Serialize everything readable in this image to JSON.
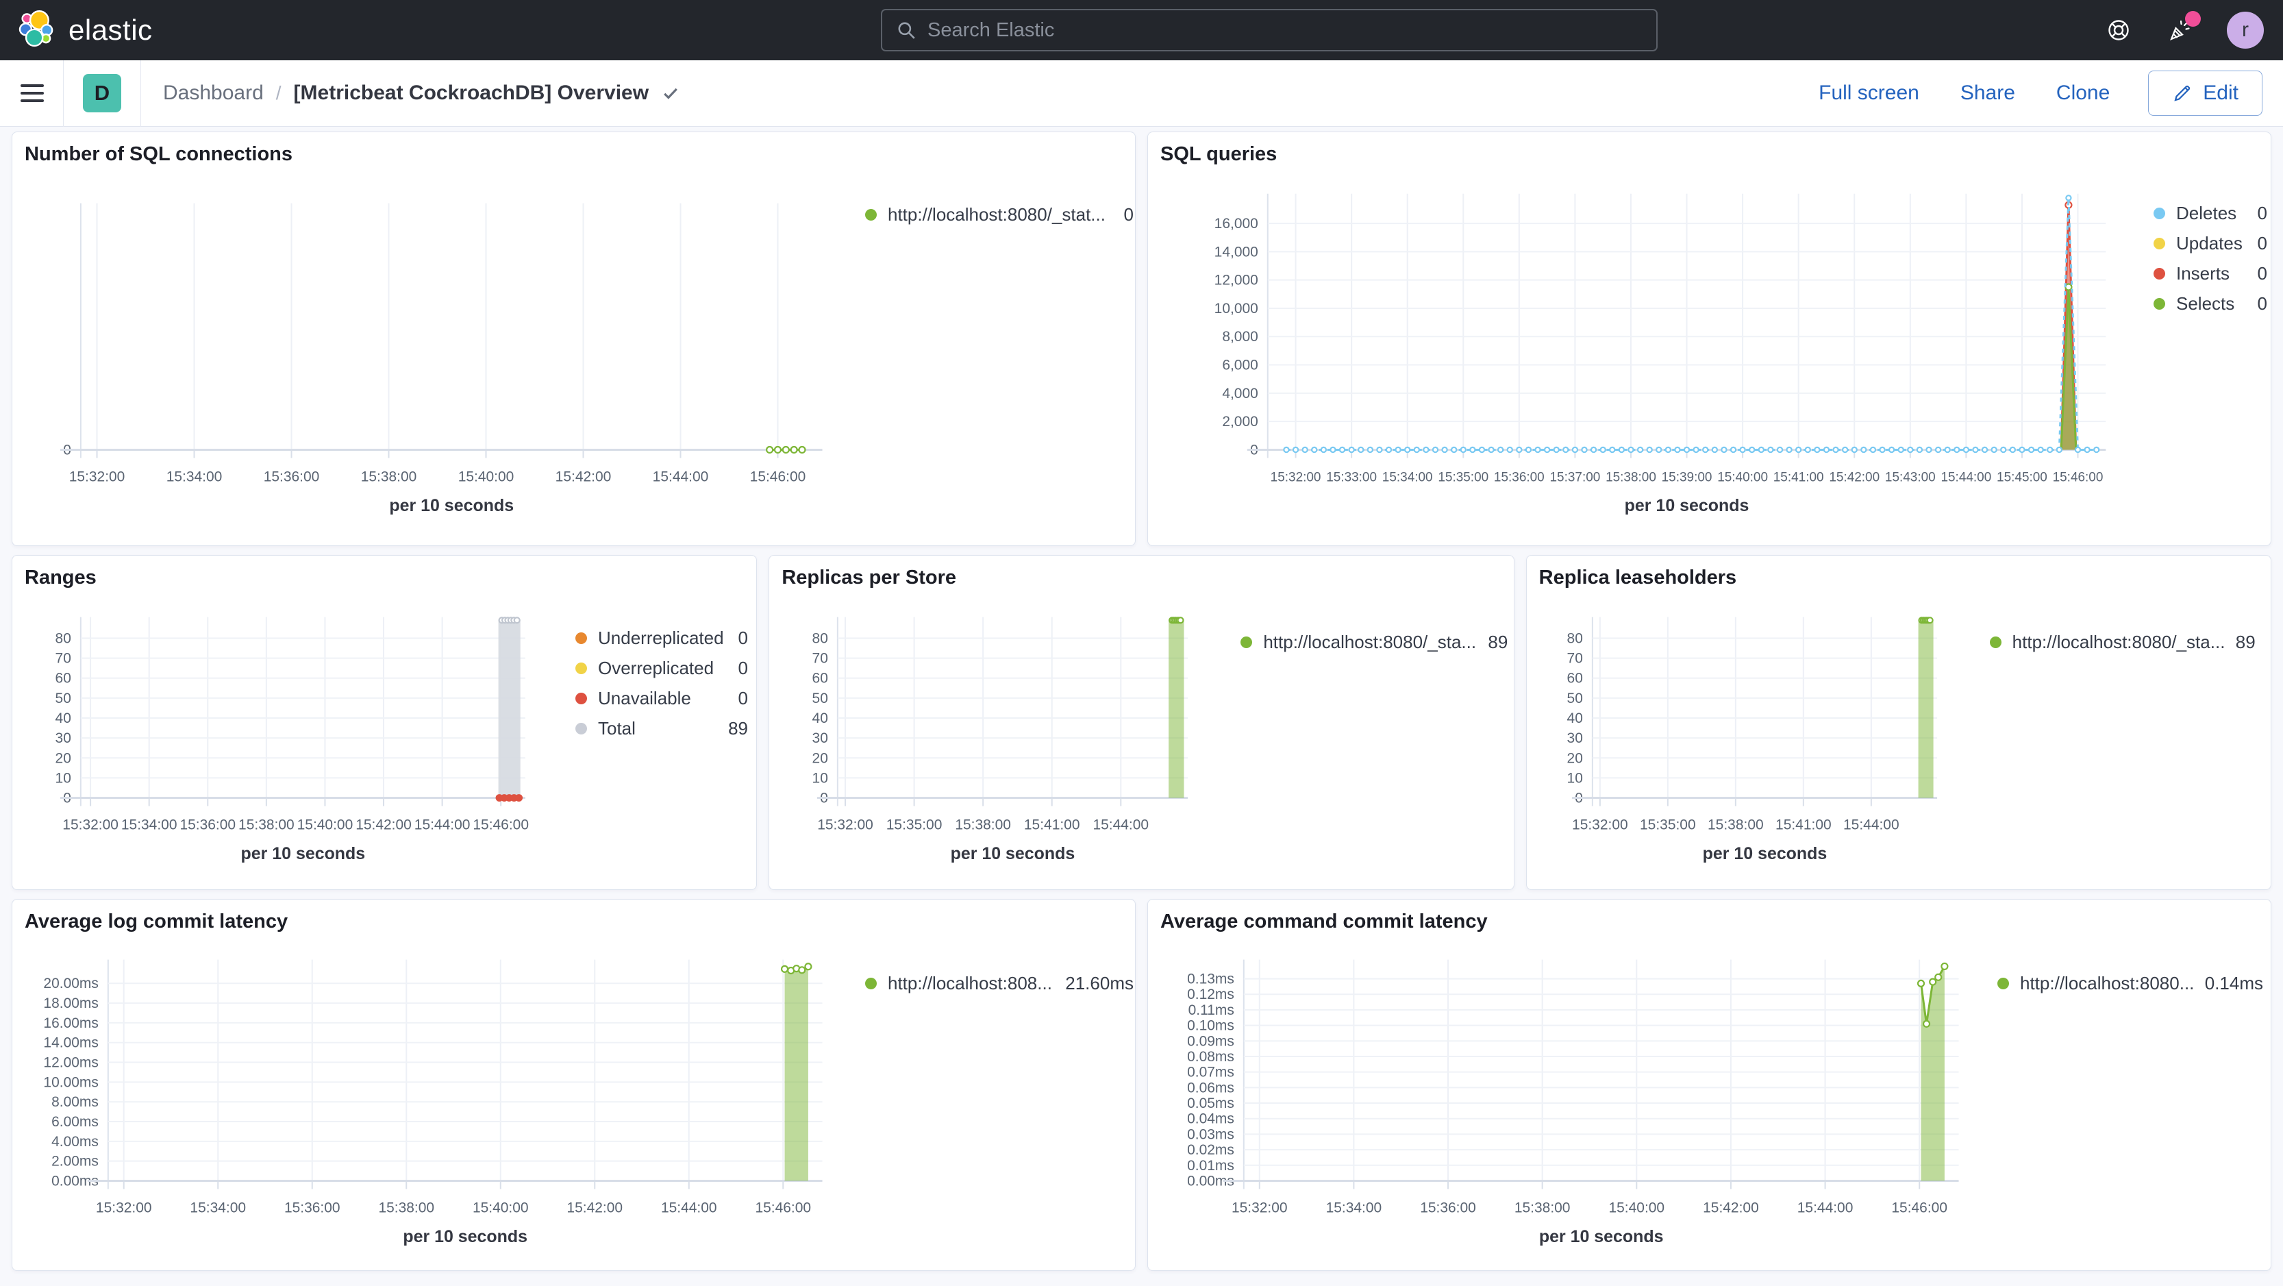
{
  "header": {
    "logo_text": "elastic",
    "search_placeholder": "Search Elastic",
    "avatar_initial": "r",
    "icons": {
      "help": "life-ring-icon",
      "news": "party-popper-icon",
      "search": "magnifier-icon"
    }
  },
  "nav": {
    "space_badge": "D",
    "breadcrumb_root": "Dashboard",
    "breadcrumb_sep": "/",
    "page_title": "[Metricbeat CockroachDB] Overview",
    "actions": [
      {
        "label": "Full screen"
      },
      {
        "label": "Share"
      },
      {
        "label": "Clone"
      }
    ],
    "edit_label": "Edit",
    "accent_color": "#2463BE"
  },
  "panels": [
    {
      "id": "sql-connections",
      "title": "Number of SQL connections",
      "legend": [
        {
          "label": "http://localhost:8080/_stat...",
          "value": "0",
          "color": "#7DB637"
        }
      ],
      "chart_data": {
        "type": "line",
        "xlabel": "per 10 seconds",
        "x_domain": [
          "15:31:40",
          "15:46:55"
        ],
        "x_ticks": [
          "15:32:00",
          "15:34:00",
          "15:36:00",
          "15:38:00",
          "15:40:00",
          "15:42:00",
          "15:44:00",
          "15:46:00"
        ],
        "y_ticks": [
          {
            "v": 0,
            "l": "0"
          }
        ],
        "ymax": 100,
        "series": [
          {
            "name": "http://localhost:8080/_stat...",
            "kind": "line",
            "color": "#7DB637",
            "markers": true,
            "range": {
              "start": "15:45:50",
              "end": "15:46:30",
              "step": 10,
              "value": 0
            }
          }
        ]
      }
    },
    {
      "id": "sql-queries",
      "title": "SQL queries",
      "legend": [
        {
          "label": "Deletes",
          "value": "0",
          "color": "#79C9F2"
        },
        {
          "label": "Updates",
          "value": "0",
          "color": "#F1D347"
        },
        {
          "label": "Inserts",
          "value": "0",
          "color": "#DE5140"
        },
        {
          "label": "Selects",
          "value": "0",
          "color": "#7DB637"
        }
      ],
      "chart_data": {
        "type": "line",
        "xlabel": "per 10 seconds",
        "x_domain": [
          "15:31:30",
          "15:46:30"
        ],
        "x_ticks": [
          "15:32:00",
          "15:33:00",
          "15:34:00",
          "15:35:00",
          "15:36:00",
          "15:37:00",
          "15:38:00",
          "15:39:00",
          "15:40:00",
          "15:41:00",
          "15:42:00",
          "15:43:00",
          "15:44:00",
          "15:45:00",
          "15:46:00"
        ],
        "y_ticks": [
          {
            "v": 0,
            "l": "0"
          },
          {
            "v": 2000,
            "l": "2,000"
          },
          {
            "v": 4000,
            "l": "4,000"
          },
          {
            "v": 6000,
            "l": "6,000"
          },
          {
            "v": 8000,
            "l": "8,000"
          },
          {
            "v": 10000,
            "l": "10,000"
          },
          {
            "v": 12000,
            "l": "12,000"
          },
          {
            "v": 14000,
            "l": "14,000"
          },
          {
            "v": 16000,
            "l": "16,000"
          }
        ],
        "ymax": 18100,
        "series": [
          {
            "name": "Inserts",
            "kind": "area",
            "color": "#DE5140",
            "opacity": 0.6,
            "markers": "peak",
            "points": [
              [
                "15:45:42",
                0
              ],
              [
                "15:45:50",
                17300
              ],
              [
                "15:45:58",
                0
              ]
            ]
          },
          {
            "name": "Selects",
            "kind": "area",
            "color": "#7DB637",
            "opacity": 0.6,
            "markers": "peak",
            "points": [
              [
                "15:45:42",
                0
              ],
              [
                "15:45:50",
                11500
              ],
              [
                "15:45:58",
                0
              ]
            ]
          },
          {
            "name": "Deletes",
            "kind": "line",
            "color": "#79C9F2",
            "dashed": true,
            "markers": true,
            "mr": 3.6,
            "range": {
              "start": "15:31:50",
              "end": "15:46:25",
              "step": 10,
              "value": 0
            },
            "spike": {
              "t": "15:45:50",
              "v": 17800
            }
          }
        ]
      }
    },
    {
      "id": "ranges",
      "title": "Ranges",
      "legend": [
        {
          "label": "Underreplicated",
          "value": "0",
          "color": "#E8882F"
        },
        {
          "label": "Overreplicated",
          "value": "0",
          "color": "#F1D347"
        },
        {
          "label": "Unavailable",
          "value": "0",
          "color": "#DE5140"
        },
        {
          "label": "Total",
          "value": "89",
          "color": "#C9CDD6"
        }
      ],
      "chart_data": {
        "type": "bar",
        "xlabel": "per 10 seconds",
        "x_domain": [
          "15:31:40",
          "15:46:50"
        ],
        "x_ticks": [
          "15:32:00",
          "15:34:00",
          "15:36:00",
          "15:38:00",
          "15:40:00",
          "15:42:00",
          "15:44:00",
          "15:46:00"
        ],
        "y_ticks": [
          {
            "v": 0,
            "l": "0"
          },
          {
            "v": 10,
            "l": "10"
          },
          {
            "v": 20,
            "l": "20"
          },
          {
            "v": 30,
            "l": "30"
          },
          {
            "v": 40,
            "l": "40"
          },
          {
            "v": 50,
            "l": "50"
          },
          {
            "v": 60,
            "l": "60"
          },
          {
            "v": 70,
            "l": "70"
          },
          {
            "v": 80,
            "l": "80"
          }
        ],
        "ymax": 90.6,
        "series": [
          {
            "name": "Total",
            "kind": "bar",
            "color": "#D5D9E0",
            "opacity": 0.9,
            "marker_color": "#BFC5CF",
            "bar": {
              "from": "15:45:55",
              "to": "15:46:40",
              "value": 89
            }
          },
          {
            "name": "Unavailable",
            "kind": "dots",
            "color": "#DE5140",
            "range": {
              "start": "15:45:57",
              "end": "15:46:37",
              "step": 10,
              "value": 0
            }
          }
        ]
      }
    },
    {
      "id": "replicas-per-store",
      "title": "Replicas per Store",
      "legend": [
        {
          "label": "http://localhost:8080/_sta...",
          "value": "89",
          "color": "#7DB637"
        }
      ],
      "chart_data": {
        "type": "bar",
        "xlabel": "per 10 seconds",
        "x_domain": [
          "15:31:40",
          "15:46:55"
        ],
        "x_ticks": [
          "15:32:00",
          "15:35:00",
          "15:38:00",
          "15:41:00",
          "15:44:00"
        ],
        "y_ticks": [
          {
            "v": 0,
            "l": "0"
          },
          {
            "v": 10,
            "l": "10"
          },
          {
            "v": 20,
            "l": "20"
          },
          {
            "v": 30,
            "l": "30"
          },
          {
            "v": 40,
            "l": "40"
          },
          {
            "v": 50,
            "l": "50"
          },
          {
            "v": 60,
            "l": "60"
          },
          {
            "v": 70,
            "l": "70"
          },
          {
            "v": 80,
            "l": "80"
          }
        ],
        "ymax": 90.6,
        "series": [
          {
            "name": "http://localhost:8080/_sta...",
            "kind": "bar",
            "color": "#7DB637",
            "opacity": 0.5,
            "marker_color": "#7DB637",
            "bar": {
              "from": "15:46:05",
              "to": "15:46:45",
              "value": 89
            }
          }
        ]
      }
    },
    {
      "id": "replica-leaseholders",
      "title": "Replica leaseholders",
      "legend": [
        {
          "label": "http://localhost:8080/_sta...",
          "value": "89",
          "color": "#7DB637"
        }
      ],
      "chart_data": {
        "type": "bar",
        "xlabel": "per 10 seconds",
        "x_domain": [
          "15:31:40",
          "15:46:55"
        ],
        "x_ticks": [
          "15:32:00",
          "15:35:00",
          "15:38:00",
          "15:41:00",
          "15:44:00"
        ],
        "y_ticks": [
          {
            "v": 0,
            "l": "0"
          },
          {
            "v": 10,
            "l": "10"
          },
          {
            "v": 20,
            "l": "20"
          },
          {
            "v": 30,
            "l": "30"
          },
          {
            "v": 40,
            "l": "40"
          },
          {
            "v": 50,
            "l": "50"
          },
          {
            "v": 60,
            "l": "60"
          },
          {
            "v": 70,
            "l": "70"
          },
          {
            "v": 80,
            "l": "80"
          }
        ],
        "ymax": 90.6,
        "series": [
          {
            "name": "http://localhost:8080/_sta...",
            "kind": "bar",
            "color": "#7DB637",
            "opacity": 0.5,
            "marker_color": "#7DB637",
            "bar": {
              "from": "15:46:05",
              "to": "15:46:45",
              "value": 89
            }
          }
        ]
      }
    },
    {
      "id": "avg-log-commit-latency",
      "title": "Average log commit latency",
      "legend": [
        {
          "label": "http://localhost:808...",
          "value": "21.60ms",
          "color": "#7DB637"
        }
      ],
      "chart_data": {
        "type": "area",
        "xlabel": "per 10 seconds",
        "x_domain": [
          "15:31:40",
          "15:46:50"
        ],
        "x_ticks": [
          "15:32:00",
          "15:34:00",
          "15:36:00",
          "15:38:00",
          "15:40:00",
          "15:42:00",
          "15:44:00",
          "15:46:00"
        ],
        "y_ticks": [
          {
            "v": 0,
            "l": "0.00ms"
          },
          {
            "v": 2,
            "l": "2.00ms"
          },
          {
            "v": 4,
            "l": "4.00ms"
          },
          {
            "v": 6,
            "l": "6.00ms"
          },
          {
            "v": 8,
            "l": "8.00ms"
          },
          {
            "v": 10,
            "l": "10.00ms"
          },
          {
            "v": 12,
            "l": "12.00ms"
          },
          {
            "v": 14,
            "l": "14.00ms"
          },
          {
            "v": 16,
            "l": "16.00ms"
          },
          {
            "v": 18,
            "l": "18.00ms"
          },
          {
            "v": 20,
            "l": "20.00ms"
          }
        ],
        "ymax": 22.4,
        "series": [
          {
            "name": "http://localhost:808...",
            "kind": "area",
            "color": "#7DB637",
            "opacity": 0.5,
            "markers": true,
            "points": [
              [
                "15:46:02",
                21.45
              ],
              [
                "15:46:10",
                21.3
              ],
              [
                "15:46:17",
                21.5
              ],
              [
                "15:46:24",
                21.35
              ],
              [
                "15:46:32",
                21.7
              ]
            ]
          }
        ]
      }
    },
    {
      "id": "avg-command-commit-latency",
      "title": "Average command commit latency",
      "legend": [
        {
          "label": "http://localhost:8080...",
          "value": "0.14ms",
          "color": "#7DB637"
        }
      ],
      "chart_data": {
        "type": "area",
        "xlabel": "per 10 seconds",
        "x_domain": [
          "15:31:40",
          "15:46:50"
        ],
        "x_ticks": [
          "15:32:00",
          "15:34:00",
          "15:36:00",
          "15:38:00",
          "15:40:00",
          "15:42:00",
          "15:44:00",
          "15:46:00"
        ],
        "y_ticks": [
          {
            "v": 0,
            "l": "0.00ms"
          },
          {
            "v": 0.01,
            "l": "0.01ms"
          },
          {
            "v": 0.02,
            "l": "0.02ms"
          },
          {
            "v": 0.03,
            "l": "0.03ms"
          },
          {
            "v": 0.04,
            "l": "0.04ms"
          },
          {
            "v": 0.05,
            "l": "0.05ms"
          },
          {
            "v": 0.06,
            "l": "0.06ms"
          },
          {
            "v": 0.07,
            "l": "0.07ms"
          },
          {
            "v": 0.08,
            "l": "0.08ms"
          },
          {
            "v": 0.09,
            "l": "0.09ms"
          },
          {
            "v": 0.1,
            "l": "0.10ms"
          },
          {
            "v": 0.11,
            "l": "0.11ms"
          },
          {
            "v": 0.12,
            "l": "0.12ms"
          },
          {
            "v": 0.13,
            "l": "0.13ms"
          }
        ],
        "ymax": 0.1423,
        "series": [
          {
            "name": "http://localhost:8080...",
            "kind": "area",
            "color": "#7DB637",
            "opacity": 0.5,
            "markers": true,
            "points": [
              [
                "15:46:02",
                0.127
              ],
              [
                "15:46:09",
                0.101
              ],
              [
                "15:46:17",
                0.128
              ],
              [
                "15:46:24",
                0.131
              ],
              [
                "15:46:32",
                0.138
              ]
            ]
          }
        ]
      }
    }
  ]
}
